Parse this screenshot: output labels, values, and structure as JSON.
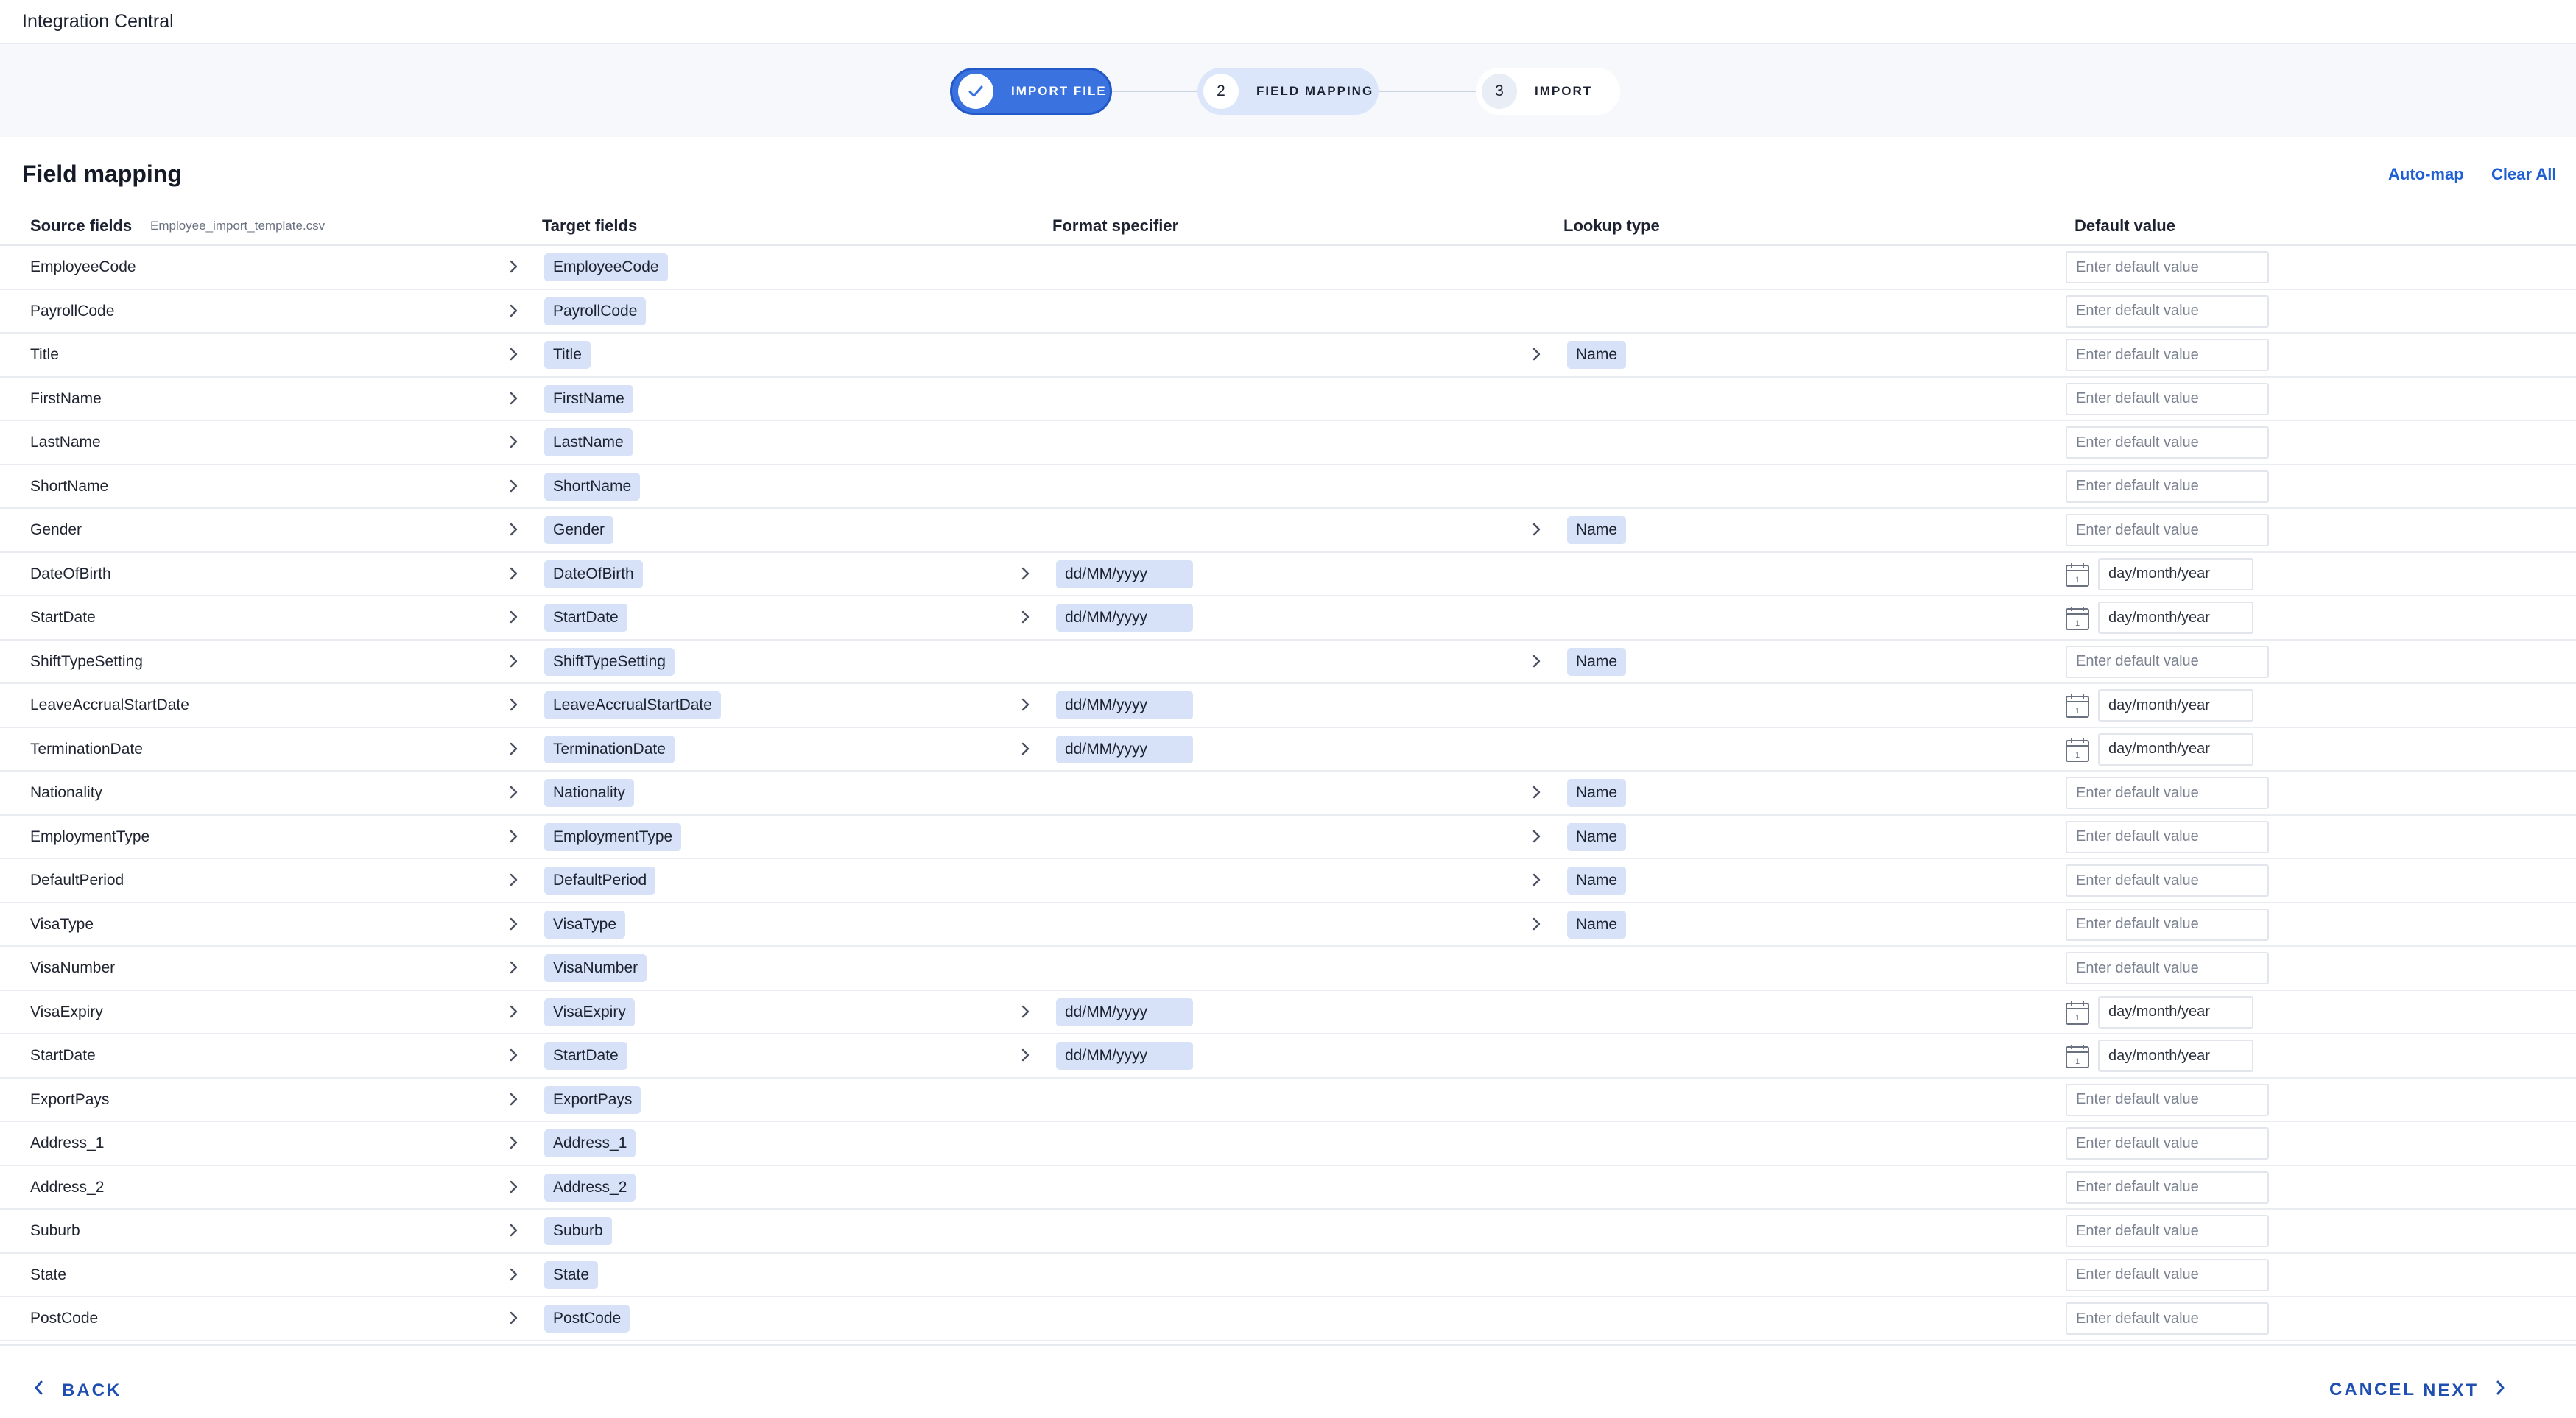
{
  "app": {
    "title": "Integration Central"
  },
  "stepper": {
    "steps": [
      {
        "number": "",
        "label": "IMPORT FILE",
        "state": "done"
      },
      {
        "number": "2",
        "label": "FIELD MAPPING",
        "state": "active"
      },
      {
        "number": "3",
        "label": "IMPORT",
        "state": "pending"
      }
    ]
  },
  "section": {
    "title": "Field mapping",
    "auto_map_label": "Auto-map",
    "clear_all_label": "Clear All"
  },
  "columns": {
    "source": "Source fields",
    "source_file": "Employee_import_template.csv",
    "target": "Target fields",
    "format": "Format specifier",
    "lookup": "Lookup type",
    "default": "Default value"
  },
  "placeholders": {
    "default_value": "Enter default value",
    "date": "day/month/year"
  },
  "rows": [
    {
      "source": "EmployeeCode",
      "target": "EmployeeCode",
      "format": "",
      "lookup": "",
      "default_type": "text"
    },
    {
      "source": "PayrollCode",
      "target": "PayrollCode",
      "format": "",
      "lookup": "",
      "default_type": "text"
    },
    {
      "source": "Title",
      "target": "Title",
      "format": "",
      "lookup": "Name",
      "default_type": "text"
    },
    {
      "source": "FirstName",
      "target": "FirstName",
      "format": "",
      "lookup": "",
      "default_type": "text"
    },
    {
      "source": "LastName",
      "target": "LastName",
      "format": "",
      "lookup": "",
      "default_type": "text"
    },
    {
      "source": "ShortName",
      "target": "ShortName",
      "format": "",
      "lookup": "",
      "default_type": "text"
    },
    {
      "source": "Gender",
      "target": "Gender",
      "format": "",
      "lookup": "Name",
      "default_type": "text"
    },
    {
      "source": "DateOfBirth",
      "target": "DateOfBirth",
      "format": "dd/MM/yyyy",
      "lookup": "",
      "default_type": "date"
    },
    {
      "source": "StartDate",
      "target": "StartDate",
      "format": "dd/MM/yyyy",
      "lookup": "",
      "default_type": "date"
    },
    {
      "source": "ShiftTypeSetting",
      "target": "ShiftTypeSetting",
      "format": "",
      "lookup": "Name",
      "default_type": "text"
    },
    {
      "source": "LeaveAccrualStartDate",
      "target": "LeaveAccrualStartDate",
      "format": "dd/MM/yyyy",
      "lookup": "",
      "default_type": "date"
    },
    {
      "source": "TerminationDate",
      "target": "TerminationDate",
      "format": "dd/MM/yyyy",
      "lookup": "",
      "default_type": "date"
    },
    {
      "source": "Nationality",
      "target": "Nationality",
      "format": "",
      "lookup": "Name",
      "default_type": "text"
    },
    {
      "source": "EmploymentType",
      "target": "EmploymentType",
      "format": "",
      "lookup": "Name",
      "default_type": "text"
    },
    {
      "source": "DefaultPeriod",
      "target": "DefaultPeriod",
      "format": "",
      "lookup": "Name",
      "default_type": "text"
    },
    {
      "source": "VisaType",
      "target": "VisaType",
      "format": "",
      "lookup": "Name",
      "default_type": "text"
    },
    {
      "source": "VisaNumber",
      "target": "VisaNumber",
      "format": "",
      "lookup": "",
      "default_type": "text"
    },
    {
      "source": "VisaExpiry",
      "target": "VisaExpiry",
      "format": "dd/MM/yyyy",
      "lookup": "",
      "default_type": "date"
    },
    {
      "source": "StartDate",
      "target": "StartDate",
      "format": "dd/MM/yyyy",
      "lookup": "",
      "default_type": "date"
    },
    {
      "source": "ExportPays",
      "target": "ExportPays",
      "format": "",
      "lookup": "",
      "default_type": "text"
    },
    {
      "source": "Address_1",
      "target": "Address_1",
      "format": "",
      "lookup": "",
      "default_type": "text"
    },
    {
      "source": "Address_2",
      "target": "Address_2",
      "format": "",
      "lookup": "",
      "default_type": "text"
    },
    {
      "source": "Suburb",
      "target": "Suburb",
      "format": "",
      "lookup": "",
      "default_type": "text"
    },
    {
      "source": "State",
      "target": "State",
      "format": "",
      "lookup": "",
      "default_type": "text"
    },
    {
      "source": "PostCode",
      "target": "PostCode",
      "format": "",
      "lookup": "",
      "default_type": "text"
    }
  ],
  "footer": {
    "back_label": "BACK",
    "cancel_label": "CANCEL",
    "next_label": "NEXT"
  },
  "icons": {
    "step_done": "check-icon",
    "row_arrow": "chevron-right-icon",
    "date_picker": "calendar-icon",
    "back": "chevron-left-icon",
    "next": "chevron-right-icon"
  },
  "colors": {
    "accent": "#3a73e0",
    "chip": "#d7e2f8",
    "link": "#1f5fd1"
  }
}
